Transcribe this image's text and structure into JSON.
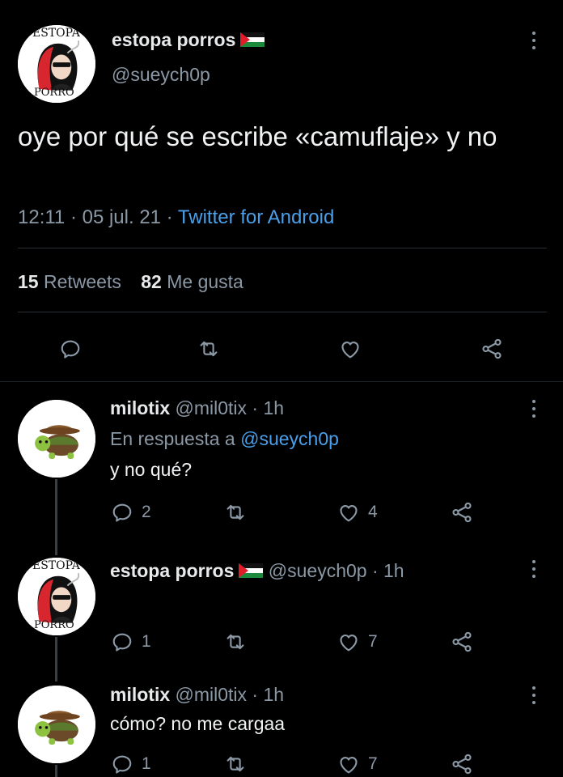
{
  "tweet": {
    "author_name": "estopa porros",
    "author_handle": "@sueych0p",
    "text": "oye por qué se escribe «camuflaje» y no",
    "time": "12:11 · 05 jul. 21 ·",
    "source": "Twitter for Android",
    "retweets_count": "15",
    "retweets_label": "Retweets",
    "likes_count": "82",
    "likes_label": "Me gusta",
    "avatar_text_top": "ESTOPA",
    "avatar_text_bottom": "PORRO"
  },
  "replies": [
    {
      "name": "milotix",
      "handle_time": "@mil0tix · 1h",
      "reply_to_prefix": "En respuesta a",
      "reply_to_handle": "@sueych0p",
      "text": "y no qué?",
      "reply_count": "2",
      "retweet_count": "",
      "like_count": "4"
    },
    {
      "name": "estopa porros",
      "handle_time": "@sueych0p · 1h",
      "text": "",
      "reply_count": "1",
      "retweet_count": "",
      "like_count": "7",
      "avatar_text_top": "ESTOPA",
      "avatar_text_bottom": "PORRO"
    },
    {
      "name": "milotix",
      "handle_time": "@mil0tix · 1h",
      "text": "cómo? no me cargaa",
      "reply_count": "1",
      "retweet_count": "",
      "like_count": "7"
    }
  ],
  "icons": [
    "reply-icon",
    "retweet-icon",
    "like-icon",
    "share-icon",
    "more-icon",
    "palestine-flag-icon"
  ],
  "colors": {
    "background": "#000000",
    "text": "#e7e9ea",
    "muted": "#8b98a5",
    "link": "#4a9fea",
    "divider": "#2a2f33"
  }
}
